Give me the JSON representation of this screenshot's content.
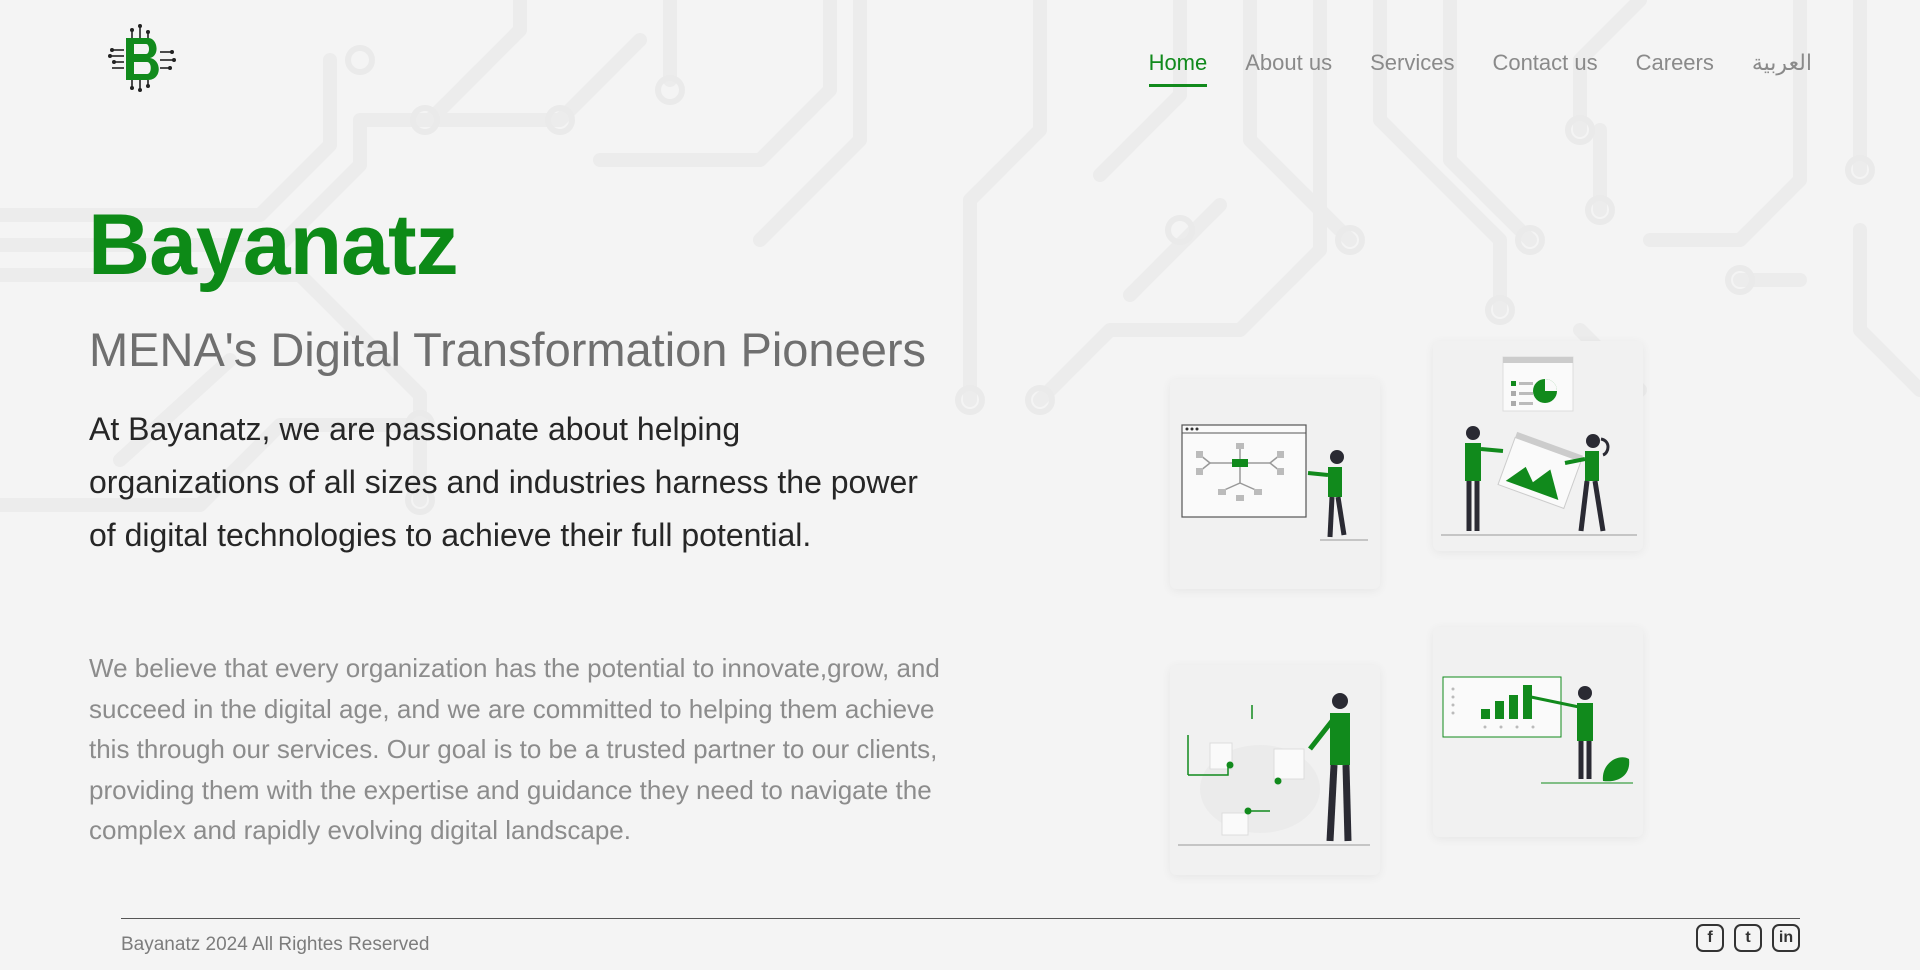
{
  "brand": {
    "logo_icon": "circuit-b-logo",
    "name": "Bayanatz"
  },
  "nav": {
    "items": [
      {
        "label": "Home",
        "active": true
      },
      {
        "label": "About us",
        "active": false
      },
      {
        "label": "Services",
        "active": false
      },
      {
        "label": "Contact us",
        "active": false
      },
      {
        "label": "Careers",
        "active": false
      },
      {
        "label": "العربية",
        "active": false
      }
    ]
  },
  "hero": {
    "title": "Bayanatz",
    "tagline": "MENA's Digital Transformation Pioneers",
    "lead": "At Bayanatz, we are passionate about helping organizations of all sizes and industries harness the power of digital technologies to achieve their full potential.",
    "body": "We believe that every organization has the potential to innovate,grow, and succeed in the digital age, and we are committed to helping them achieve this through our services. Our goal is to be a trusted partner to our clients, providing them with the expertise and guidance they need to navigate the complex and rapidly evolving digital landscape."
  },
  "illustrations": [
    {
      "icon": "flowchart-presentation-illustration"
    },
    {
      "icon": "team-analytics-illustration"
    },
    {
      "icon": "workflow-notes-illustration"
    },
    {
      "icon": "bar-chart-presentation-illustration"
    }
  ],
  "footer": {
    "copyright": "Bayanatz 2024 All Rightes Reserved",
    "socials": [
      {
        "icon": "facebook-icon",
        "glyph": "f"
      },
      {
        "icon": "twitter-icon",
        "glyph": "t"
      },
      {
        "icon": "linkedin-icon",
        "glyph": "in"
      }
    ]
  },
  "colors": {
    "accent": "#0d8a17",
    "background": "#f4f4f4",
    "muted_text": "#8c8c8c",
    "dark_text": "#262626"
  }
}
